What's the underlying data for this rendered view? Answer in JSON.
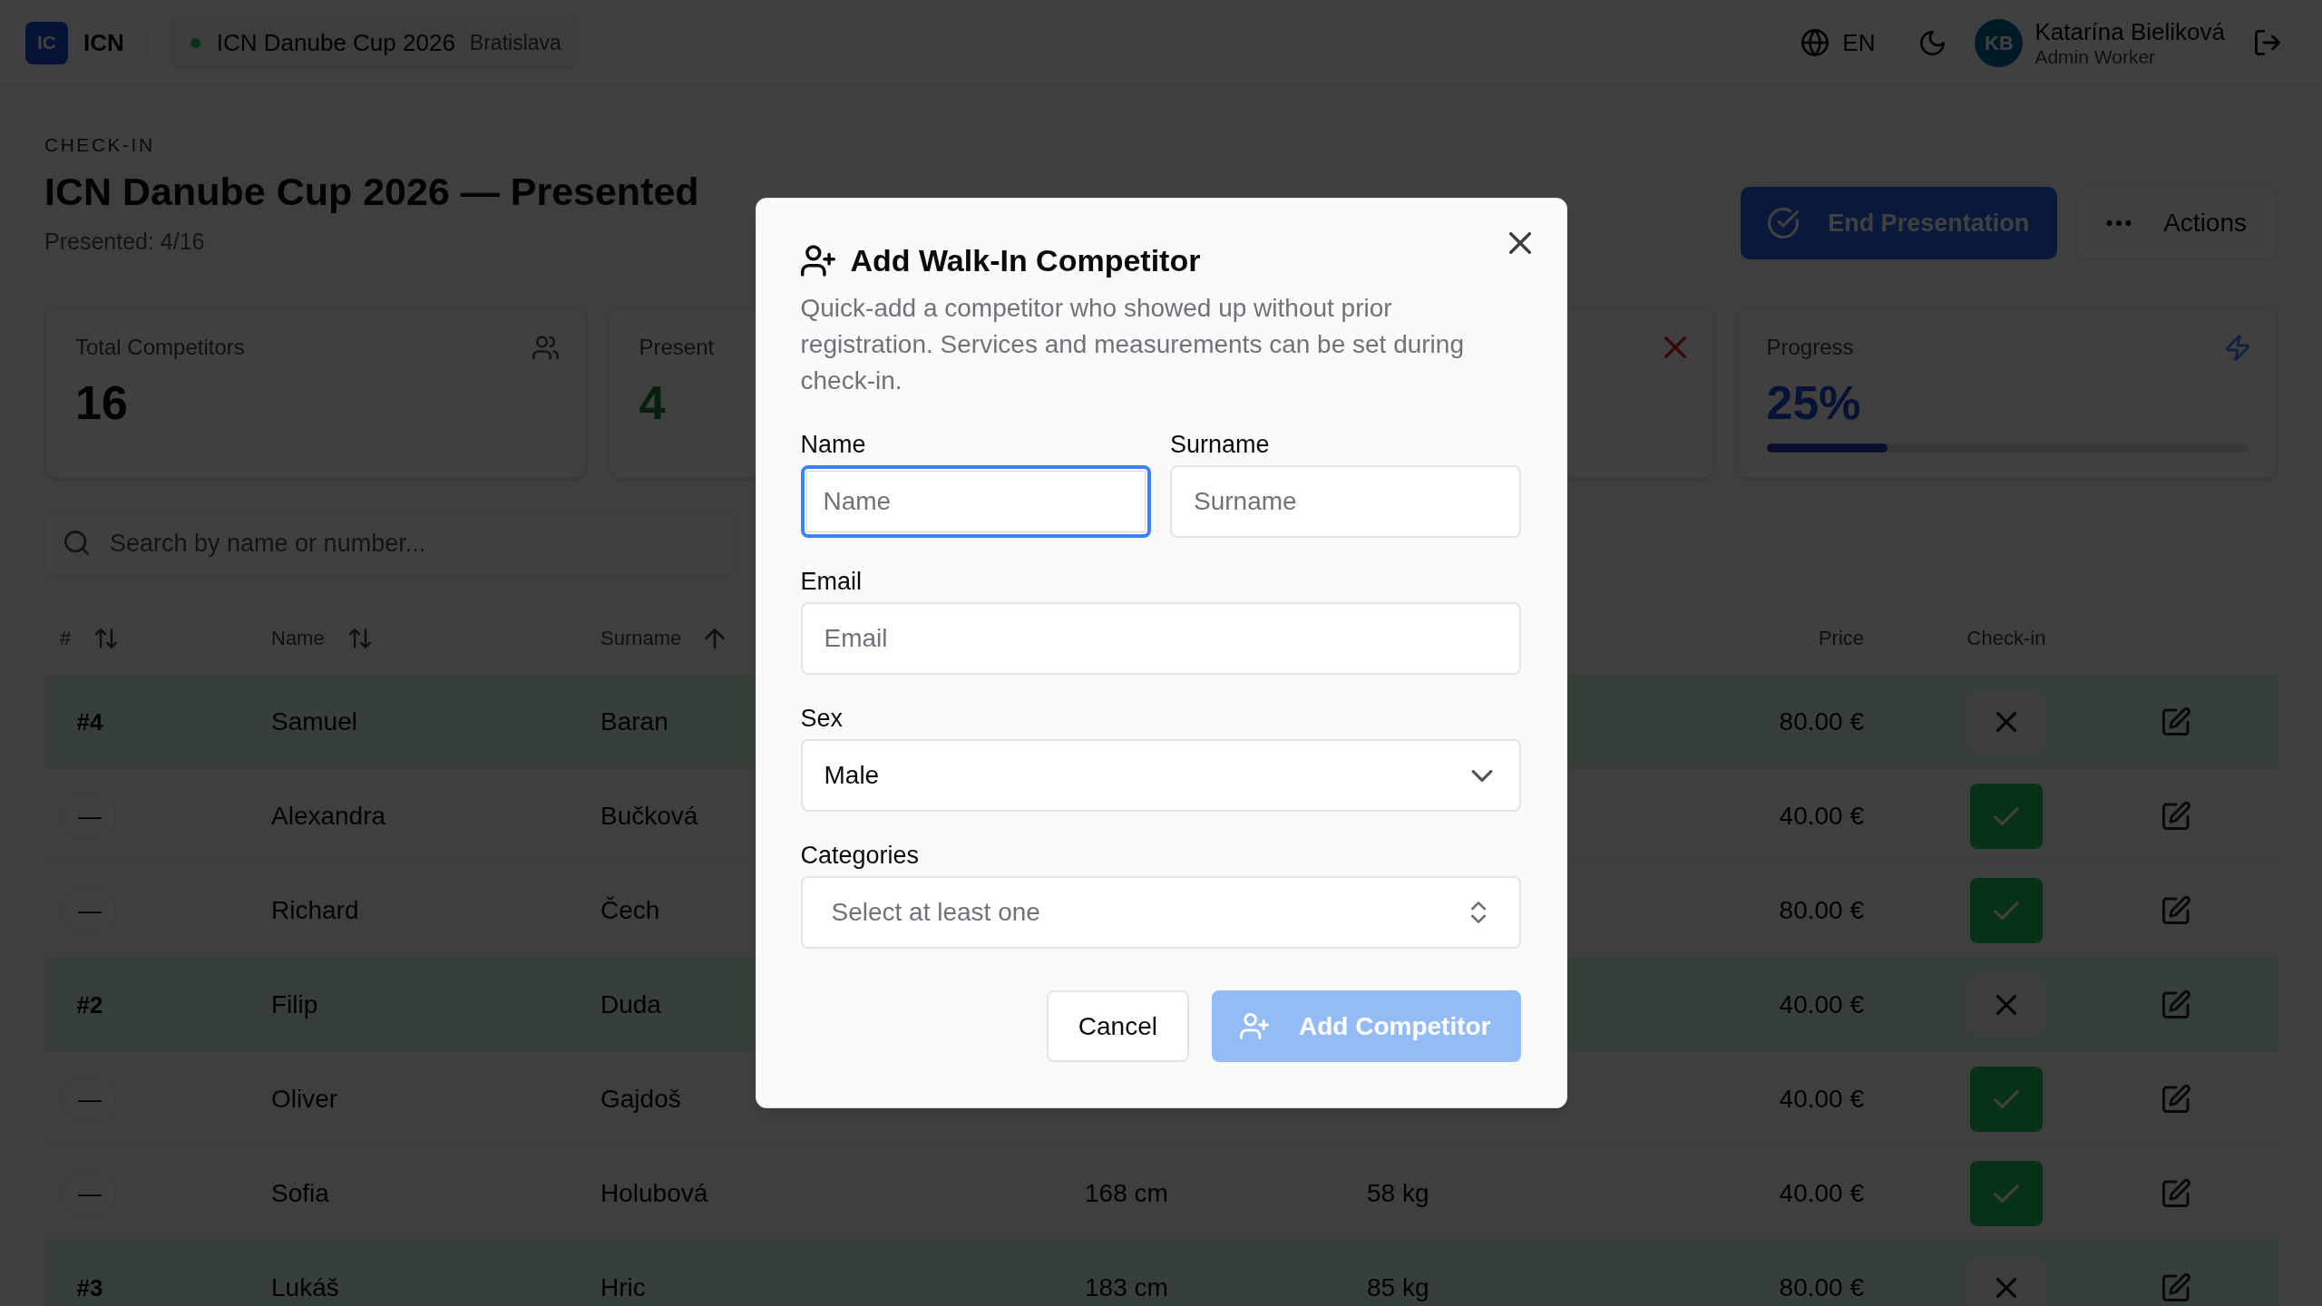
{
  "top_bar": {
    "logo": {
      "initials": "IC",
      "text": "ICN"
    },
    "event": {
      "name": "ICN Danube Cup 2026",
      "city": "Bratislava"
    },
    "language": "EN",
    "user": {
      "initials": "KB",
      "name": "Katarína Bieliková",
      "role": "Admin Worker"
    }
  },
  "header": {
    "eyebrow": "CHECK-IN",
    "title": "ICN Danube Cup 2026 — Presented",
    "subtitle": "Presented: 4/16",
    "buttons": [
      {
        "kind": "primary",
        "label": "End Presentation"
      },
      {
        "kind": "ghost",
        "label": "Actions"
      }
    ]
  },
  "stats": [
    {
      "kind": "neutral",
      "label": "Total Competitors",
      "value": "16"
    },
    {
      "kind": "success",
      "label": "Present",
      "value": "4"
    },
    {
      "kind": "danger"
    },
    {
      "kind": "progress",
      "label": "Progress",
      "value": "25%",
      "level": 0.25
    }
  ],
  "search": {
    "placeholder": "Search by name or number..."
  },
  "table": {
    "columns": [
      {
        "label": "#",
        "sorted": false
      },
      {
        "label": "Name",
        "sorted": false
      },
      {
        "label": "Surname",
        "sorted": true
      },
      {
        "label": "Price"
      },
      {
        "label": "Check-in"
      }
    ],
    "rows": [
      {
        "number": "#4",
        "name": "Samuel",
        "surname": "Baran",
        "price": "80.00 €",
        "present": true
      },
      {
        "number": "—",
        "name": "Alexandra",
        "surname": "Bučková",
        "price": "40.00 €",
        "present": false
      },
      {
        "number": "—",
        "name": "Richard",
        "surname": "Čech",
        "price": "80.00 €",
        "present": false
      },
      {
        "number": "#2",
        "name": "Filip",
        "surname": "Duda",
        "price": "40.00 €",
        "present": true
      },
      {
        "number": "—",
        "name": "Oliver",
        "surname": "Gajdoš",
        "price": "40.00 €",
        "present": false
      },
      {
        "number": "—",
        "name": "Sofia",
        "surname": "Holubová",
        "column_4": "168 cm",
        "column_5": "58 kg",
        "price": "40.00 €",
        "present": false
      },
      {
        "number": "#3",
        "name": "Lukáš",
        "surname": "Hric",
        "column_4": "183 cm",
        "column_5": "85 kg",
        "price": "80.00 €",
        "present": true
      }
    ]
  },
  "dialog": {
    "title": "Add Walk-In Competitor",
    "description": "Quick-add a competitor who showed up without prior registration. Services and measurements can be set during check-in.",
    "field_rows": [
      [
        {
          "kind": "text",
          "label": "Name",
          "placeholder": "Name",
          "focused": true
        },
        {
          "kind": "text",
          "label": "Surname",
          "placeholder": "Surname",
          "focused": false
        }
      ],
      [
        {
          "kind": "text",
          "label": "Email",
          "placeholder": "Email",
          "focused": false
        }
      ],
      [
        {
          "kind": "select",
          "label": "Sex",
          "value": "Male"
        }
      ],
      [
        {
          "kind": "multiselect",
          "label": "Categories",
          "placeholder": "Select at least one"
        }
      ]
    ],
    "buttons": [
      {
        "kind": "secondary",
        "label": "Cancel",
        "disabled": false
      },
      {
        "kind": "primary",
        "label": "Add Competitor",
        "disabled": true
      }
    ]
  }
}
